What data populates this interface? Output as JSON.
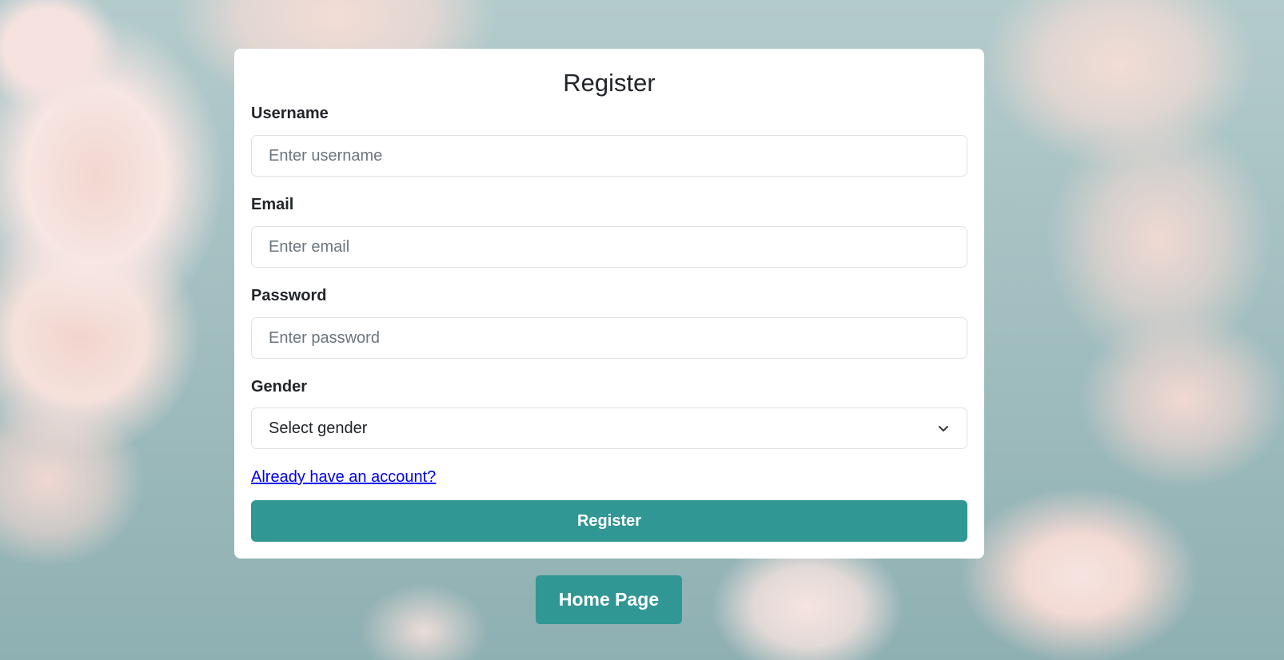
{
  "form": {
    "title": "Register",
    "username_label": "Username",
    "username_placeholder": "Enter username",
    "email_label": "Email",
    "email_placeholder": "Enter email",
    "password_label": "Password",
    "password_placeholder": "Enter password",
    "gender_label": "Gender",
    "gender_selected": "Select gender",
    "login_link": "Already have an account?",
    "submit_label": "Register"
  },
  "nav": {
    "home_label": "Home Page"
  },
  "icons": {
    "select_chevron": "chevron-down-icon"
  },
  "colors": {
    "accent": "#319795",
    "link": "#0000ee"
  }
}
